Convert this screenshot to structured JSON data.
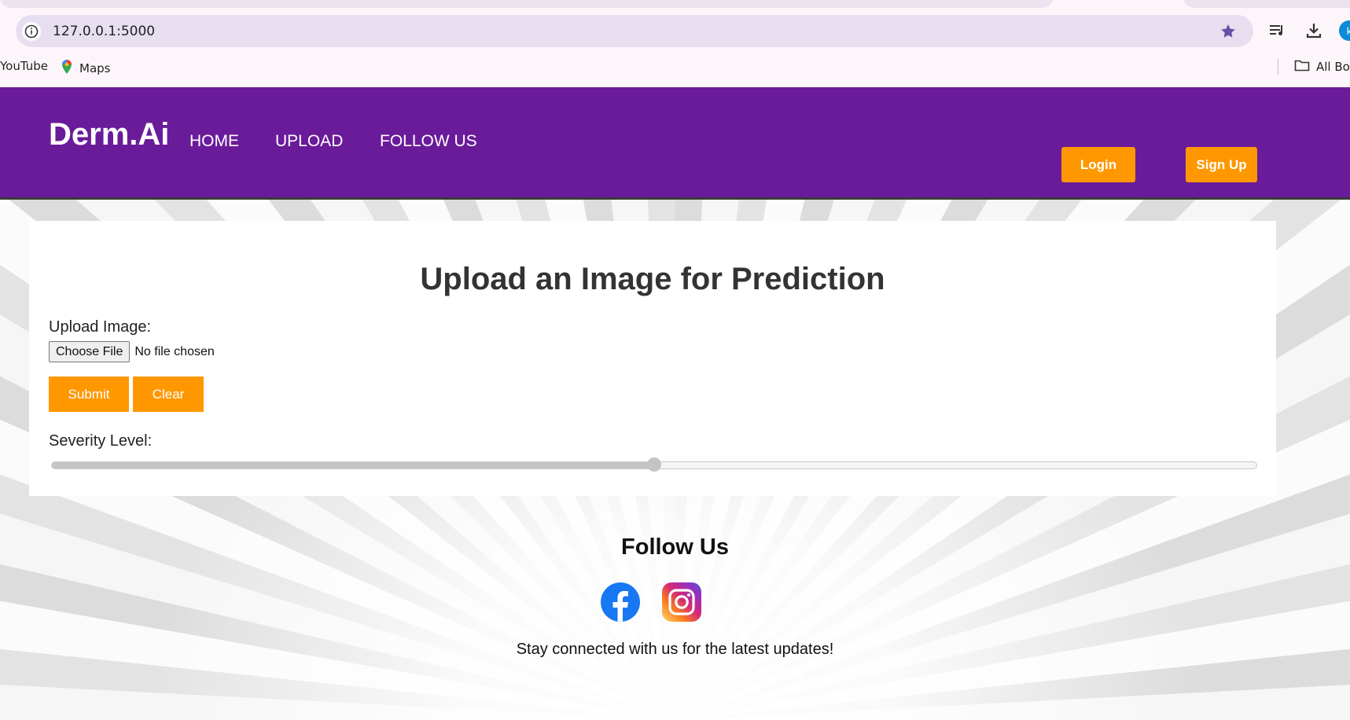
{
  "browser": {
    "url": "127.0.0.1:5000",
    "bookmarks": [
      "YouTube",
      "Maps"
    ],
    "all_bookmarks_label": "All Bo",
    "profile_initial": "k"
  },
  "nav": {
    "brand": "Derm.Ai",
    "links": [
      "HOME",
      "UPLOAD",
      "FOLLOW US"
    ],
    "login_label": "Login",
    "signup_label": "Sign Up"
  },
  "upload": {
    "title": "Upload an Image for Prediction",
    "image_label": "Upload Image:",
    "choose_file_label": "Choose File",
    "file_status": "No file chosen",
    "submit_label": "Submit",
    "clear_label": "Clear",
    "severity_label": "Severity Level:",
    "severity_value_fraction": 0.5
  },
  "footer": {
    "title": "Follow Us",
    "socials": [
      "facebook-icon",
      "instagram-icon"
    ],
    "tagline": "Stay connected with us for the latest updates!"
  },
  "colors": {
    "navbar": "#6a1b9a",
    "accent": "#ff9800"
  }
}
